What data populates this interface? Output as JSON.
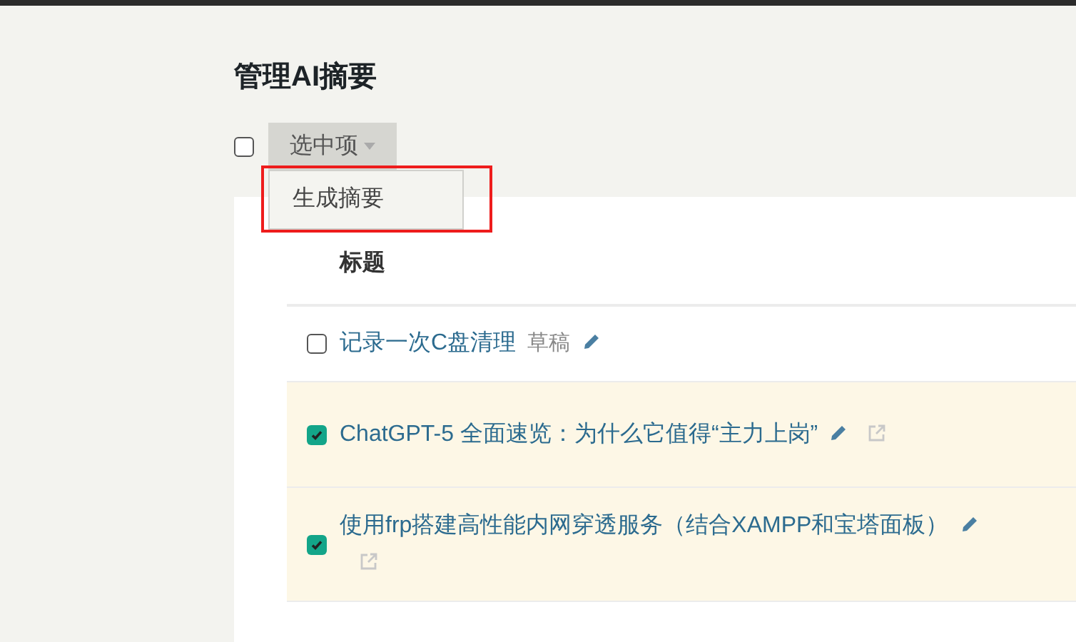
{
  "page_title": "管理AI摘要",
  "select_all": {
    "checked": false
  },
  "bulk_menu": {
    "label": "选中项",
    "items": [
      {
        "label": "生成摘要",
        "highlighted": true
      }
    ]
  },
  "table": {
    "columns": [
      "标题"
    ],
    "rows": [
      {
        "title": "记录一次C盘清理",
        "checked": false,
        "status": "草稿",
        "view_link": false
      },
      {
        "title": "ChatGPT-5 全面速览：为什么它值得“主力上岗”",
        "checked": true,
        "view_link": true
      },
      {
        "title": "使用frp搭建高性能内网穿透服务（结合XAMPP和宝塔面板）",
        "checked": true,
        "view_link": true
      }
    ]
  }
}
